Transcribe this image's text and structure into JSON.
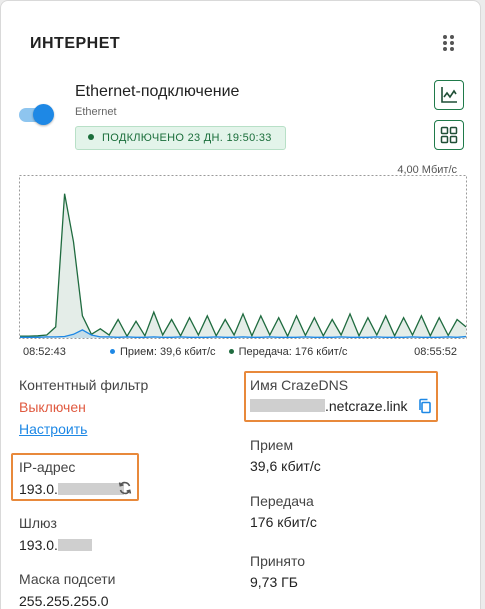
{
  "card": {
    "title": "ИНТЕРНЕТ",
    "menu_icon": "drag-dots-icon"
  },
  "connection": {
    "name": "Ethernet-подключение",
    "type": "Ethernet",
    "enabled": true,
    "status": "ПОДКЛЮЧЕНО 23 ДН. 19:50:33",
    "chart_button_icon": "chart-icon",
    "details_button_icon": "grid-icon"
  },
  "chart": {
    "max_label": "4,00 Мбит/с",
    "time_start": "08:52:43",
    "time_end": "08:55:52",
    "legend": [
      {
        "label": "Прием: 39,6 кбит/с",
        "color": "#1e88e5"
      },
      {
        "label": "Передача: 176 кбит/с",
        "color": "#1f6b3f"
      }
    ]
  },
  "chart_data": {
    "type": "area",
    "y_max_label": "4,00 Мбит/с",
    "x_range": [
      "08:52:43",
      "08:55:52"
    ],
    "ylim": [
      0,
      4.0
    ],
    "series": [
      {
        "name": "Прием",
        "color": "#1e88e5",
        "values": [
          0.02,
          0.02,
          0.02,
          0.03,
          0.03,
          0.04,
          0.1,
          0.22,
          0.08,
          0.03,
          0.03,
          0.02,
          0.03,
          0.02,
          0.02,
          0.03,
          0.02,
          0.02,
          0.03,
          0.02,
          0.02,
          0.02,
          0.03,
          0.02,
          0.02,
          0.03,
          0.02,
          0.02,
          0.03,
          0.02,
          0.02,
          0.02,
          0.03,
          0.02,
          0.02,
          0.02,
          0.03,
          0.02,
          0.02,
          0.02,
          0.03,
          0.02,
          0.02,
          0.02,
          0.03,
          0.02,
          0.02,
          0.02,
          0.03,
          0.02,
          0.04
        ]
      },
      {
        "name": "Передача",
        "color": "#1f6b3f",
        "values": [
          0.05,
          0.05,
          0.06,
          0.08,
          0.3,
          3.9,
          2.6,
          0.6,
          0.1,
          0.25,
          0.08,
          0.5,
          0.05,
          0.45,
          0.06,
          0.7,
          0.08,
          0.5,
          0.06,
          0.55,
          0.08,
          0.6,
          0.06,
          0.5,
          0.08,
          0.65,
          0.06,
          0.6,
          0.08,
          0.55,
          0.05,
          0.6,
          0.07,
          0.55,
          0.06,
          0.5,
          0.08,
          0.65,
          0.06,
          0.55,
          0.08,
          0.6,
          0.06,
          0.55,
          0.08,
          0.6,
          0.06,
          0.55,
          0.07,
          0.5,
          0.3
        ]
      }
    ]
  },
  "info": {
    "content_filter_label": "Контентный фильтр",
    "content_filter_value": "Выключен",
    "content_filter_link": "Настроить",
    "ip_label": "IP-адрес",
    "ip_prefix": "193.0.",
    "ip_refresh_icon": "refresh-icon",
    "gateway_label": "Шлюз",
    "gateway_prefix": "193.0.",
    "mask_label": "Маска подсети",
    "mask_value": "255.255.255.0",
    "dns_label": "Имя CrazeDNS",
    "dns_suffix": ".netcraze.link",
    "dns_copy_icon": "copy-icon",
    "rx_label": "Прием",
    "rx_value": "39,6 кбит/с",
    "tx_label": "Передача",
    "tx_value": "176 кбит/с",
    "received_label": "Принято",
    "received_value": "9,73 ГБ"
  },
  "colors": {
    "accent": "#1e88e5",
    "success": "#1f6b3f",
    "danger": "#e05a40",
    "highlight": "#e8893b"
  }
}
